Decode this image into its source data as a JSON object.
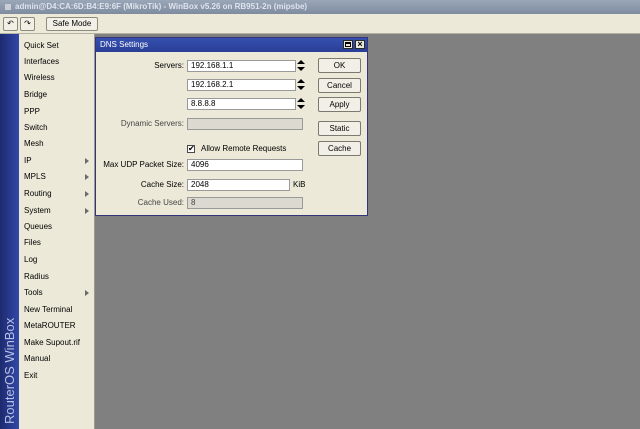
{
  "window": {
    "title": "admin@D4:CA:6D:B4:E9:6F (MikroTik) - WinBox v5.26 on RB951-2n (mipsbe)"
  },
  "toolbar": {
    "undo_icon": "↶",
    "redo_icon": "↷",
    "safe_mode_label": "Safe Mode"
  },
  "sidebar": {
    "vertical_title": "RouterOS WinBox",
    "items": [
      {
        "label": "Quick Set"
      },
      {
        "label": "Interfaces"
      },
      {
        "label": "Wireless"
      },
      {
        "label": "Bridge"
      },
      {
        "label": "PPP"
      },
      {
        "label": "Switch"
      },
      {
        "label": "Mesh"
      },
      {
        "label": "IP"
      },
      {
        "label": "MPLS"
      },
      {
        "label": "Routing"
      },
      {
        "label": "System"
      },
      {
        "label": "Queues"
      },
      {
        "label": "Files"
      },
      {
        "label": "Log"
      },
      {
        "label": "Radius"
      },
      {
        "label": "Tools"
      },
      {
        "label": "New Terminal"
      },
      {
        "label": "MetaROUTER"
      },
      {
        "label": "Make Supout.rif"
      },
      {
        "label": "Manual"
      },
      {
        "label": "Exit"
      }
    ]
  },
  "dialog": {
    "title": "DNS Settings",
    "close_glyph": "×",
    "servers_label": "Servers:",
    "servers": [
      "192.168.1.1",
      "192.168.2.1",
      "8.8.8.8"
    ],
    "dynamic_servers_label": "Dynamic Servers:",
    "dynamic_servers_value": "",
    "allow_remote_label": "Allow Remote Requests",
    "allow_remote_checked": true,
    "check_glyph": "✔",
    "max_udp_label": "Max UDP Packet Size:",
    "max_udp_value": "4096",
    "cache_size_label": "Cache Size:",
    "cache_size_value": "2048",
    "cache_size_unit": "KiB",
    "cache_used_label": "Cache Used:",
    "cache_used_value": "8",
    "buttons": {
      "ok": "OK",
      "cancel": "Cancel",
      "apply": "Apply",
      "static": "Static",
      "cache": "Cache"
    }
  }
}
